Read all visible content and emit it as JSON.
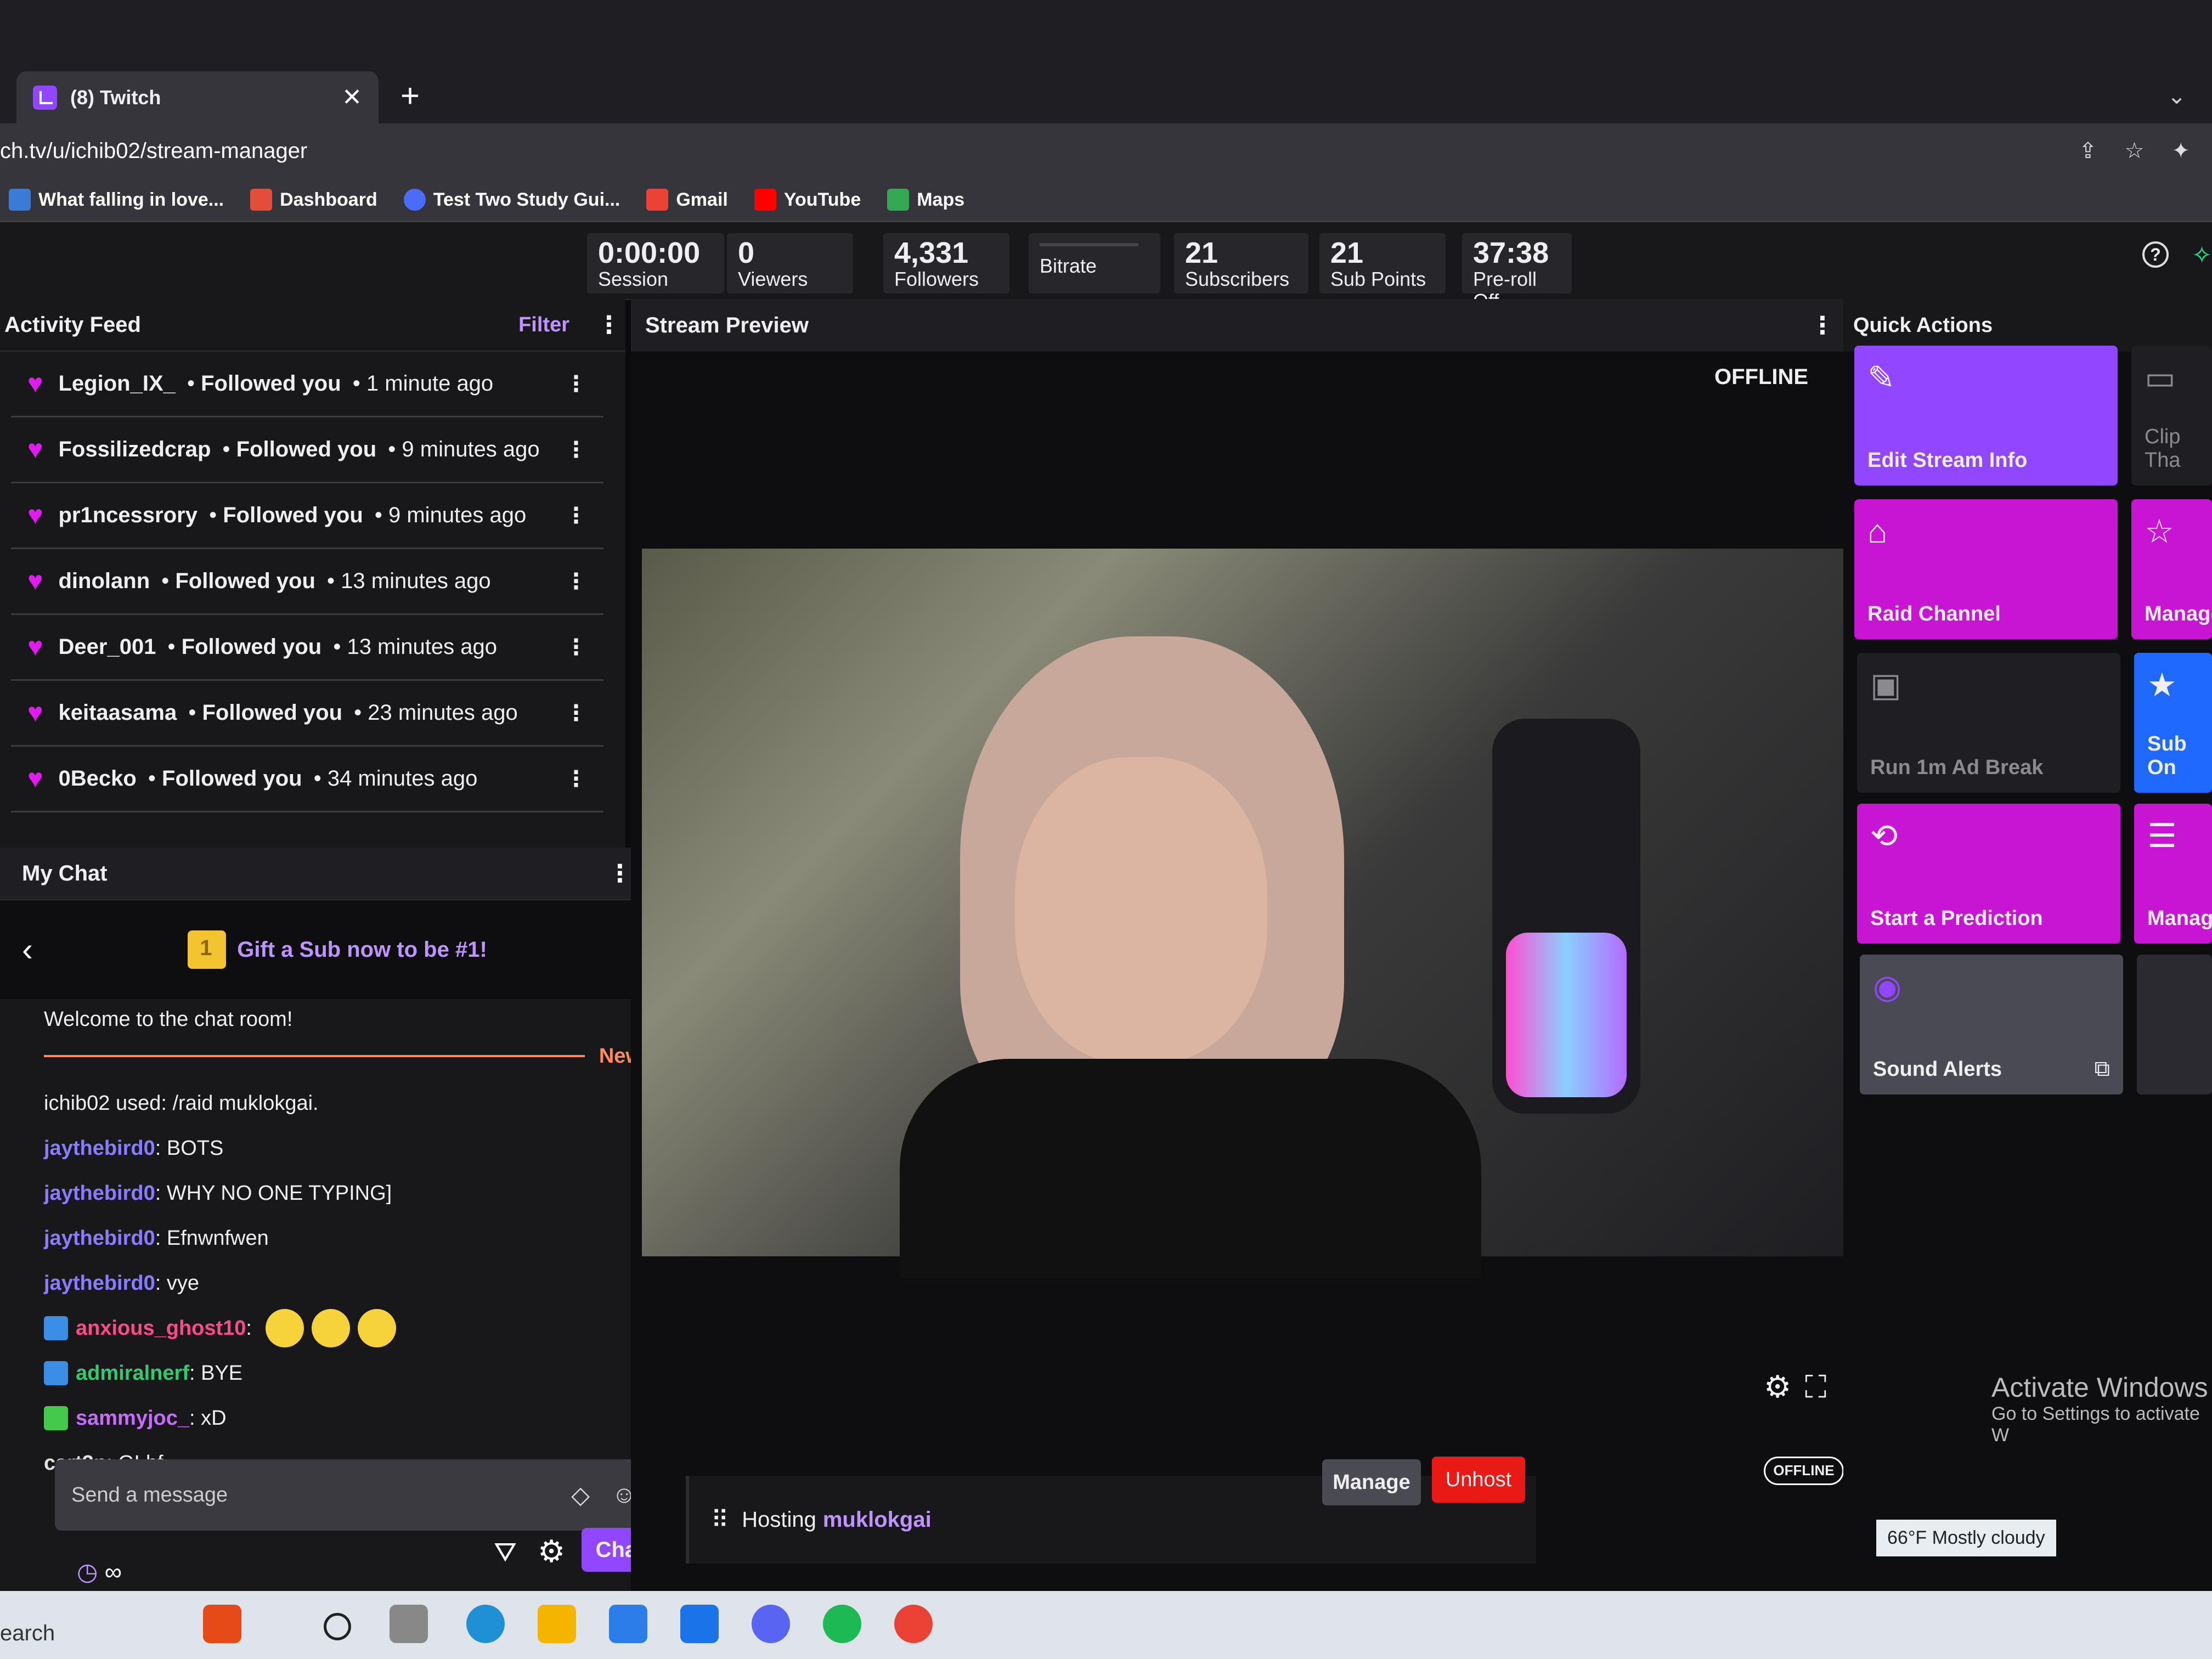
{
  "browser": {
    "tab_title": "(8) Twitch",
    "url": "ch.tv/u/ichib02/stream-manager",
    "bookmarks": [
      {
        "label": "What falling in love...",
        "color": "#3a7bd5"
      },
      {
        "label": "Dashboard",
        "color": "#e44d3a"
      },
      {
        "label": "Test Two Study Gui...",
        "color": "#4a6cf7"
      },
      {
        "label": "Gmail",
        "color": "#ea4335"
      },
      {
        "label": "YouTube",
        "color": "#ff0000"
      },
      {
        "label": "Maps",
        "color": "#34a853"
      }
    ]
  },
  "stats": {
    "session": {
      "value": "0:00:00",
      "label": "Session"
    },
    "viewers": {
      "value": "0",
      "label": "Viewers"
    },
    "followers": {
      "value": "4,331",
      "label": "Followers"
    },
    "bitrate": {
      "label": "Bitrate"
    },
    "subscribers": {
      "value": "21",
      "label": "Subscribers"
    },
    "sub_points": {
      "value": "21",
      "label": "Sub Points"
    },
    "preroll": {
      "value": "37:38",
      "label": "Pre-roll Off"
    }
  },
  "activity_feed": {
    "title": "Activity Feed",
    "filter_label": "Filter",
    "items": [
      {
        "user": "Legion_IX_",
        "action": "Followed you",
        "time": "1 minute ago"
      },
      {
        "user": "Fossilizedcrap",
        "action": "Followed you",
        "time": "9 minutes ago"
      },
      {
        "user": "pr1ncessrory",
        "action": "Followed you",
        "time": "9 minutes ago"
      },
      {
        "user": "dinolann",
        "action": "Followed you",
        "time": "13 minutes ago"
      },
      {
        "user": "Deer_001",
        "action": "Followed you",
        "time": "13 minutes ago"
      },
      {
        "user": "keitaasama",
        "action": "Followed you",
        "time": "23 minutes ago"
      },
      {
        "user": "0Becko",
        "action": "Followed you",
        "time": "34 minutes ago"
      }
    ]
  },
  "chat": {
    "title": "My Chat",
    "gift_banner": "Gift a Sub now to be #1!",
    "welcome": "Welcome to the chat room!",
    "new_label": "New",
    "system_msg": "ichib02 used: /raid muklokgai.",
    "messages": [
      {
        "user": "jaythebird0",
        "text": "BOTS",
        "color": "#8a7bff",
        "badge": ""
      },
      {
        "user": "jaythebird0",
        "text": "WHY NO ONE TYPING]",
        "color": "#8a7bff",
        "badge": ""
      },
      {
        "user": "jaythebird0",
        "text": "Efnwnfwen",
        "color": "#8a7bff",
        "badge": ""
      },
      {
        "user": "jaythebird0",
        "text": "vye",
        "color": "#8a7bff",
        "badge": ""
      },
      {
        "user": "anxious_ghost10",
        "text": "",
        "color": "#ff4a8a",
        "badge": "#3a8ee6",
        "emotes": 3
      },
      {
        "user": "admiralnerf",
        "text": "BYE",
        "color": "#2ecc71",
        "badge": "#3a8ee6"
      },
      {
        "user": "sammyjoc_",
        "text": "xD",
        "color": "#c86bff",
        "badge": "#45c94a"
      },
      {
        "user": "cart3n",
        "text": "GLhf",
        "color": "#e0e0e0",
        "badge": ""
      }
    ],
    "input_placeholder": "Send a message",
    "send_label": "Chat",
    "timer_text": "∞"
  },
  "preview": {
    "title": "Stream Preview",
    "status": "OFFLINE",
    "pill": "OFFLINE",
    "hosting_label": "Hosting",
    "hosting_channel": "muklokgai",
    "manage_label": "Manage",
    "unhost_label": "Unhost"
  },
  "quick_actions": {
    "title": "Quick Actions",
    "tiles": [
      {
        "label": "Edit Stream Info",
        "icon": "pencil-icon"
      },
      {
        "label": "Clip Tha",
        "icon": "clip-icon"
      },
      {
        "label": "Raid Channel",
        "icon": "raid-icon"
      },
      {
        "label": "Manage",
        "icon": "star-icon"
      },
      {
        "label": "Run 1m Ad Break",
        "icon": "ad-icon"
      },
      {
        "label": "Sub On",
        "icon": "star-icon"
      },
      {
        "label": "Start a Prediction",
        "icon": "prediction-icon"
      },
      {
        "label": "Manage",
        "icon": "list-icon"
      },
      {
        "label": "Sound Alerts",
        "icon": "sound-alerts-icon"
      }
    ]
  },
  "system": {
    "activate_title": "Activate Windows",
    "activate_sub": "Go to Settings to activate W",
    "weather": "66°F  Mostly cloudy",
    "search": "earch"
  }
}
